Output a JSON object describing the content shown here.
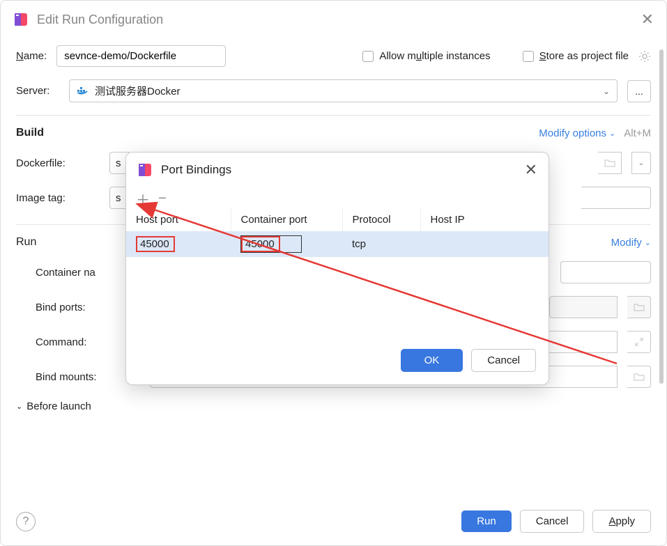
{
  "dialog": {
    "title": "Edit Run Configuration",
    "name_label_prefix": "N",
    "name_label_rest": "ame:",
    "name_value": "sevnce-demo/Dockerfile",
    "allow_multiple_prefix": "Allow m",
    "allow_multiple_u": "u",
    "allow_multiple_rest": "ltiple instances",
    "store_prefix": "S",
    "store_rest": "tore as project file",
    "server_label": "Server:",
    "server_value": "测试服务器Docker",
    "ellipsis": "...",
    "build_title": "Build",
    "modify_options": "Modify options",
    "alt_m": "Alt+M",
    "dockerfile_label": "Dockerfile:",
    "dockerfile_partial": "s",
    "image_tag_label": "Image tag:",
    "image_tag_partial": "s",
    "run_title": "Run",
    "run_modify": "Modify",
    "container_name_label": "Container na",
    "bind_ports_label": "Bind ports:",
    "command_label": "Command:",
    "bind_mounts_label": "Bind mounts:",
    "before_launch": "Before launch",
    "run_btn": "Run",
    "cancel_btn": "Cancel",
    "apply_btn_prefix": "A",
    "apply_btn_rest": "pply"
  },
  "modal": {
    "title": "Port Bindings",
    "headers": {
      "host_port": "Host port",
      "container_port": "Container port",
      "protocol": "Protocol",
      "host_ip": "Host IP"
    },
    "row": {
      "host_port": "45000",
      "container_port": "45000",
      "protocol": "tcp",
      "host_ip": ""
    },
    "ok": "OK",
    "cancel": "Cancel"
  }
}
